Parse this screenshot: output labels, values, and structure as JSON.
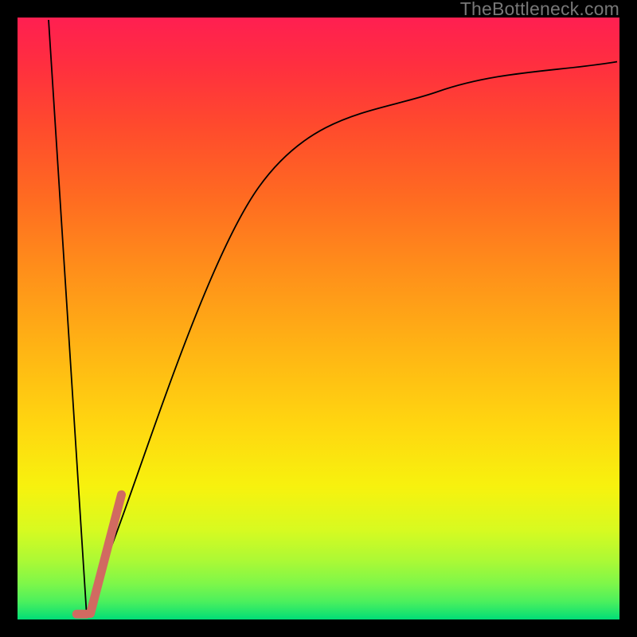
{
  "watermark": {
    "text": "TheBottleneck.com"
  },
  "border_inset": 22,
  "plot_inset": 25,
  "gradient": {
    "colors": [
      {
        "offset": 0.0,
        "hex": "#FF1F51"
      },
      {
        "offset": 0.08,
        "hex": "#FF2F3F"
      },
      {
        "offset": 0.18,
        "hex": "#FF4A2D"
      },
      {
        "offset": 0.3,
        "hex": "#FF6B21"
      },
      {
        "offset": 0.42,
        "hex": "#FF8F1A"
      },
      {
        "offset": 0.55,
        "hex": "#FFB414"
      },
      {
        "offset": 0.68,
        "hex": "#FFD710"
      },
      {
        "offset": 0.78,
        "hex": "#F7F20E"
      },
      {
        "offset": 0.85,
        "hex": "#D8FA20"
      },
      {
        "offset": 0.9,
        "hex": "#AEF934"
      },
      {
        "offset": 0.94,
        "hex": "#7FF749"
      },
      {
        "offset": 0.97,
        "hex": "#4CF05D"
      },
      {
        "offset": 0.99,
        "hex": "#1BE46E"
      },
      {
        "offset": 1.0,
        "hex": "#00DD77"
      }
    ]
  },
  "chart_data": {
    "type": "line",
    "title": "",
    "xlabel": "",
    "ylabel": "",
    "xlim": [
      0,
      100
    ],
    "ylim": [
      0,
      100
    ],
    "series": [
      {
        "name": "curve",
        "stroke": "#000000",
        "width": 1.8,
        "x": [
          4.8,
          11.2,
          15.0,
          40.0,
          70.0,
          100.0
        ],
        "values": [
          100.0,
          0.0,
          11.0,
          72.0,
          88.0,
          93.0
        ]
      },
      {
        "name": "highlight-segment",
        "stroke": "#D16A61",
        "width": 11,
        "linecap": "round",
        "x": [
          11.8,
          17.0
        ],
        "values": [
          0.6,
          20.5
        ]
      },
      {
        "name": "highlight-dot",
        "stroke": "#D16A61",
        "width": 11,
        "linecap": "round",
        "x": [
          9.5,
          11.1
        ],
        "values": [
          0.5,
          0.5
        ]
      }
    ]
  }
}
